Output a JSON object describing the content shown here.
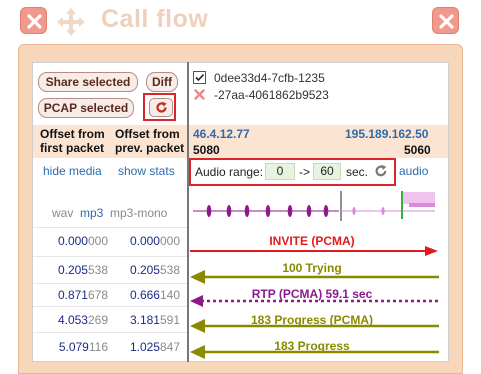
{
  "title": "Call flow",
  "colors": {
    "invite": "#e31a1c",
    "response": "#8a8a00",
    "rtp": "#8d1a8d",
    "ip": "#2d6ca8",
    "highlight_box": "#d9262b"
  },
  "toolbar": {
    "share_label": "Share selected",
    "diff_label": "Diff",
    "pcap_label": "PCAP selected",
    "refresh_icon": "refresh-icon"
  },
  "calls": [
    {
      "checked": true,
      "id": "0dee33d4-7cfb-1235"
    },
    {
      "checked": false,
      "id": "-27aa-4061862b9523",
      "icon": "remove-icon"
    }
  ],
  "columns": {
    "offset_first": "Offset from first packet",
    "offset_prev": "Offset from prev. packet"
  },
  "columns_split": {
    "offset_first_l1": "Offset from",
    "offset_first_l2": "first packet",
    "offset_prev_l1": "Offset from",
    "offset_prev_l2": "prev. packet"
  },
  "endpoints": {
    "left": {
      "ip": "46.4.12.77",
      "port": "5080"
    },
    "right": {
      "ip": "195.189.162.50",
      "port": "5060"
    }
  },
  "links": {
    "hide_media": "hide media",
    "show_stats": "show stats",
    "audio": "audio",
    "wav": "wav",
    "mp3": "mp3",
    "mp3mono": "mp3-mono"
  },
  "audio_range": {
    "label": "Audio range:",
    "from": "0",
    "arrow": "->",
    "to": "60",
    "unit": "sec."
  },
  "messages": [
    {
      "first_main": "0.000",
      "first_tail": "000",
      "prev_main": "0.000",
      "prev_tail": "000",
      "label": "INVITE (PCMA)",
      "direction": "right",
      "kind": "invite"
    },
    {
      "first_main": "0.205",
      "first_tail": "538",
      "prev_main": "0.205",
      "prev_tail": "538",
      "label": "100 Trying",
      "direction": "left",
      "kind": "response"
    },
    {
      "first_main": "0.871",
      "first_tail": "678",
      "prev_main": "0.666",
      "prev_tail": "140",
      "label": "RTP (PCMA) 59.1 sec",
      "direction": "left",
      "kind": "rtp"
    },
    {
      "first_main": "4.053",
      "first_tail": "269",
      "prev_main": "3.181",
      "prev_tail": "591",
      "label": "183 Progress (PCMA)",
      "direction": "left",
      "kind": "response"
    },
    {
      "first_main": "5.079",
      "first_tail": "116",
      "prev_main": "1.025",
      "prev_tail": "847",
      "label": "183 Progress",
      "direction": "left",
      "kind": "response"
    }
  ]
}
